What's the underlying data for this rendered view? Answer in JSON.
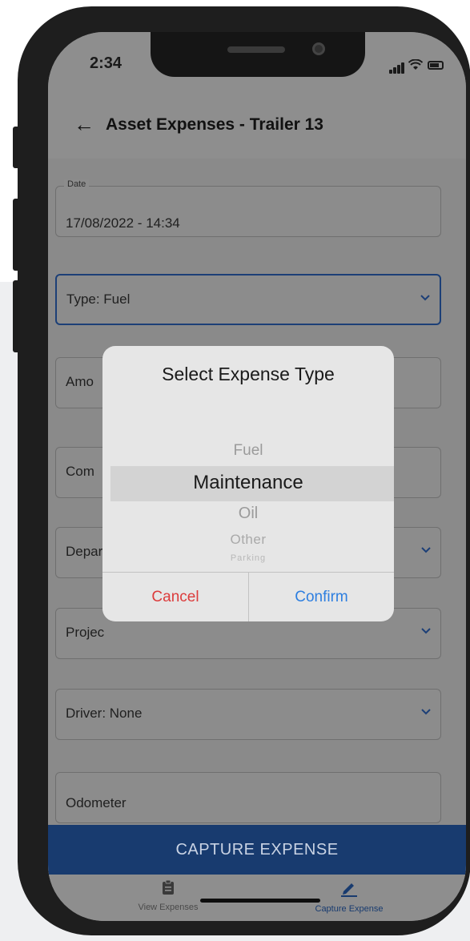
{
  "status_bar": {
    "time": "2:34"
  },
  "header": {
    "back_icon": "arrow-left-icon",
    "title": "Asset Expenses - Trailer 13"
  },
  "form": {
    "date_label": "Date",
    "date_value": "17/08/2022 - 14:34",
    "type_value": "Type: Fuel",
    "amount_partial": "Amo",
    "comment_partial": "Com",
    "department_partial": "Depar",
    "project_partial": "Projec",
    "driver_value": "Driver: None",
    "odometer_placeholder": "Odometer"
  },
  "capture_button": {
    "label": "CAPTURE EXPENSE"
  },
  "tabbar": {
    "tabs": [
      {
        "label": "View Expenses",
        "icon": "clipboard-icon",
        "active": false
      },
      {
        "label": "Capture Expense",
        "icon": "pencil-icon",
        "active": true
      }
    ]
  },
  "dialog": {
    "title": "Select Expense Type",
    "options": [
      "Fuel",
      "Maintenance",
      "Oil",
      "Other",
      "Parking"
    ],
    "selected": "Maintenance",
    "cancel_label": "Cancel",
    "confirm_label": "Confirm"
  },
  "colors": {
    "accent": "#183b6f",
    "cancel": "#dc3c3c",
    "confirm": "#2e7fe0"
  }
}
